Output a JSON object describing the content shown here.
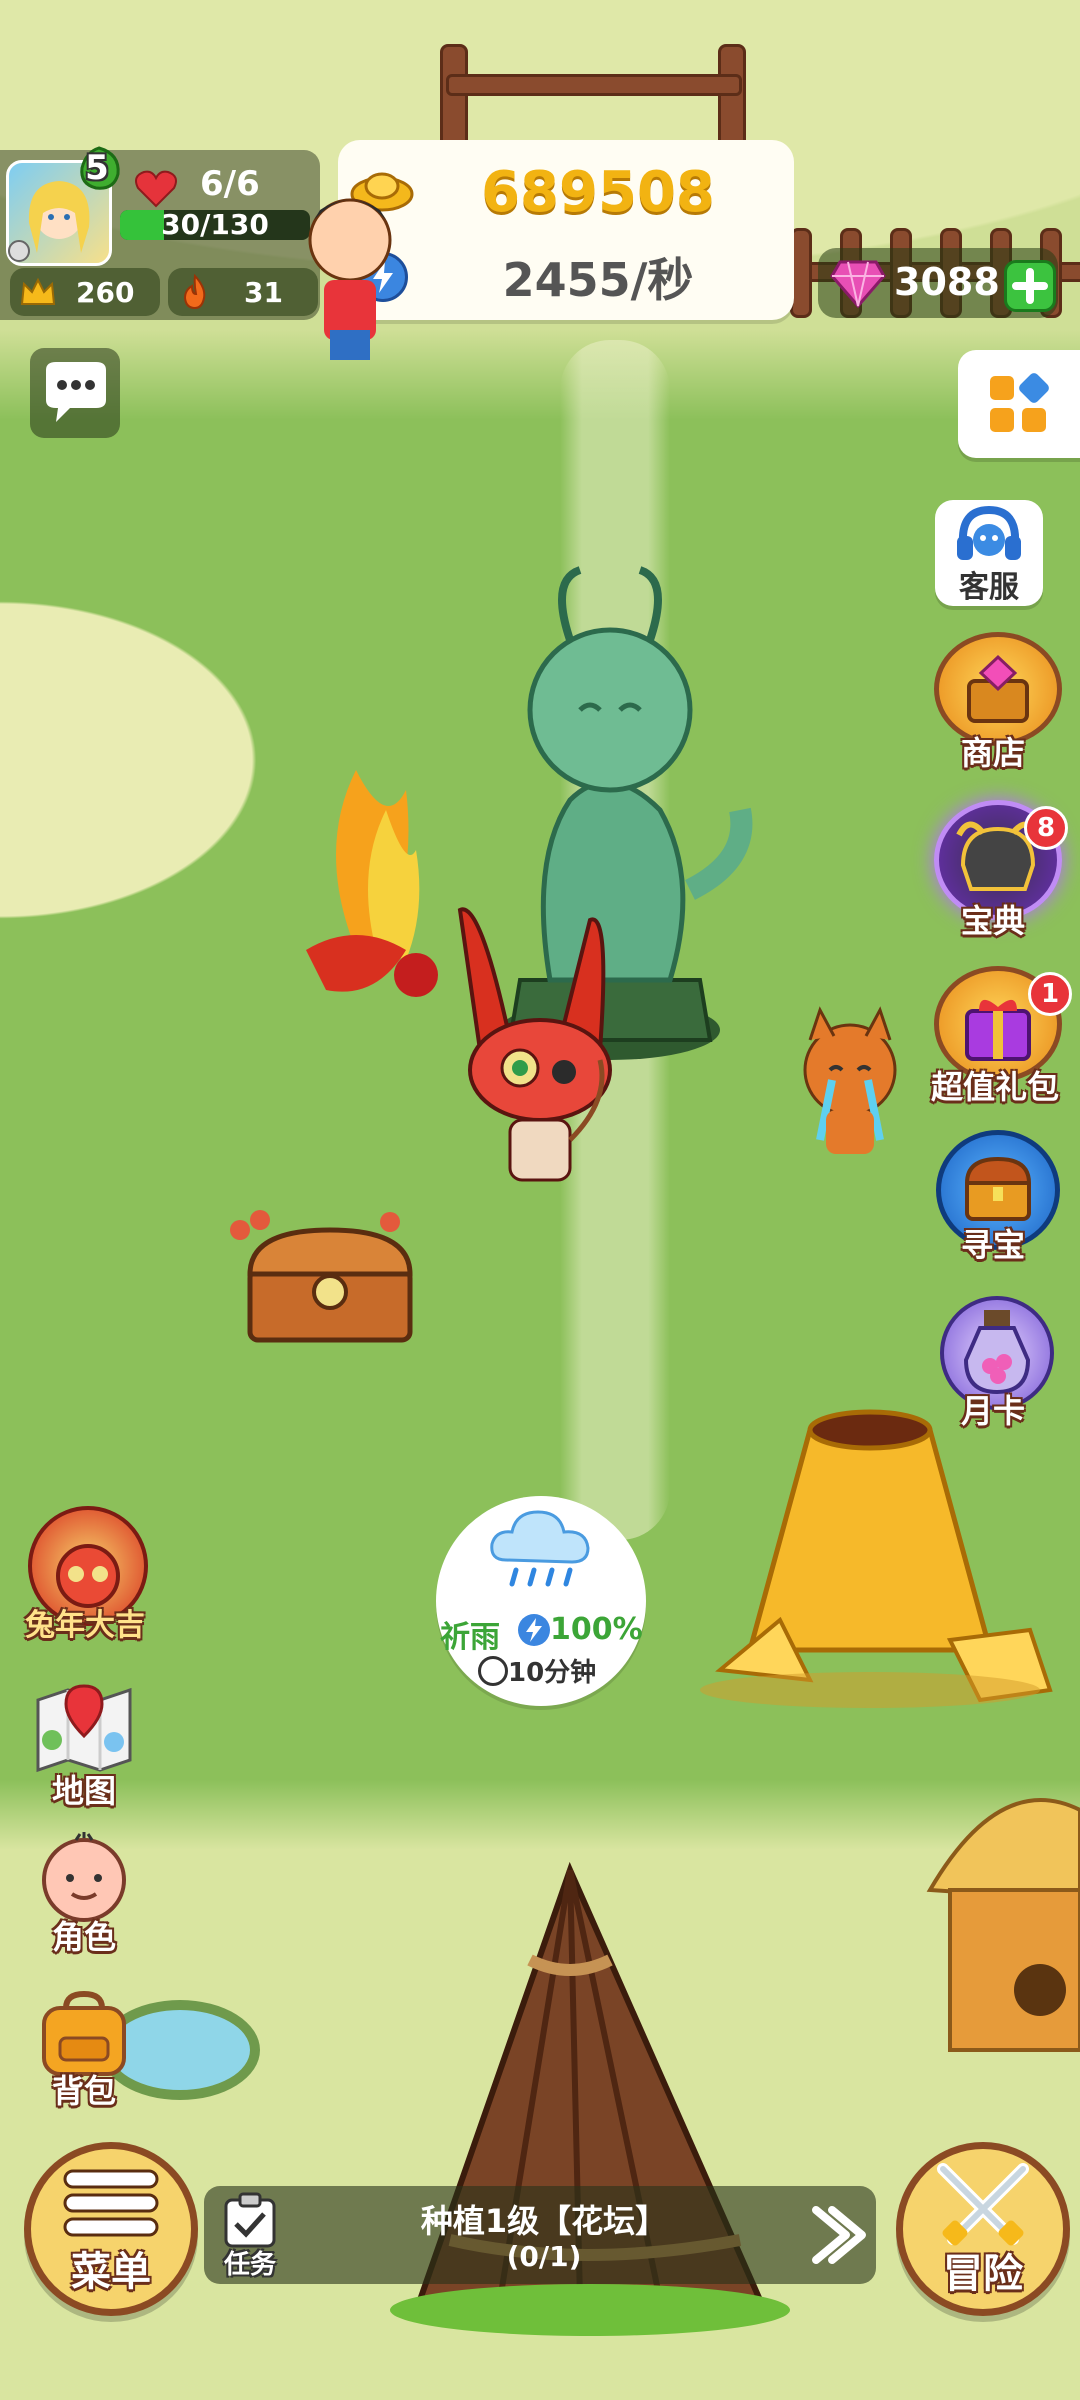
{
  "player": {
    "level": "5",
    "hearts": "6/6",
    "energy": "30/130",
    "crowns": "260",
    "fire": "31"
  },
  "resources": {
    "gold": "689508",
    "rate": "2455/秒",
    "gems": "3088"
  },
  "right_menu": {
    "service": "客服",
    "shop": "商店",
    "treasury": "宝典",
    "treasury_badge": "8",
    "gift": "超值礼包",
    "gift_badge": "1",
    "treasure_hunt": "寻宝",
    "monthly_card": "月卡"
  },
  "left_menu": {
    "rabbit_event": "兔年大吉",
    "map": "地图",
    "character": "角色",
    "backpack": "背包"
  },
  "weather": {
    "name": "祈雨",
    "percent": "100%",
    "time": "10分钟"
  },
  "bottom": {
    "menu": "菜单",
    "task_label": "任务",
    "task_title": "种植1级【花坛】",
    "task_progress": "(0/1)",
    "adventure": "冒险"
  },
  "colors": {
    "gold_text": "#f2b312",
    "gem": "#e84fb5",
    "green_bar": "#35c23a",
    "badge_red": "#e8343a"
  },
  "energy_fill": 0.23
}
